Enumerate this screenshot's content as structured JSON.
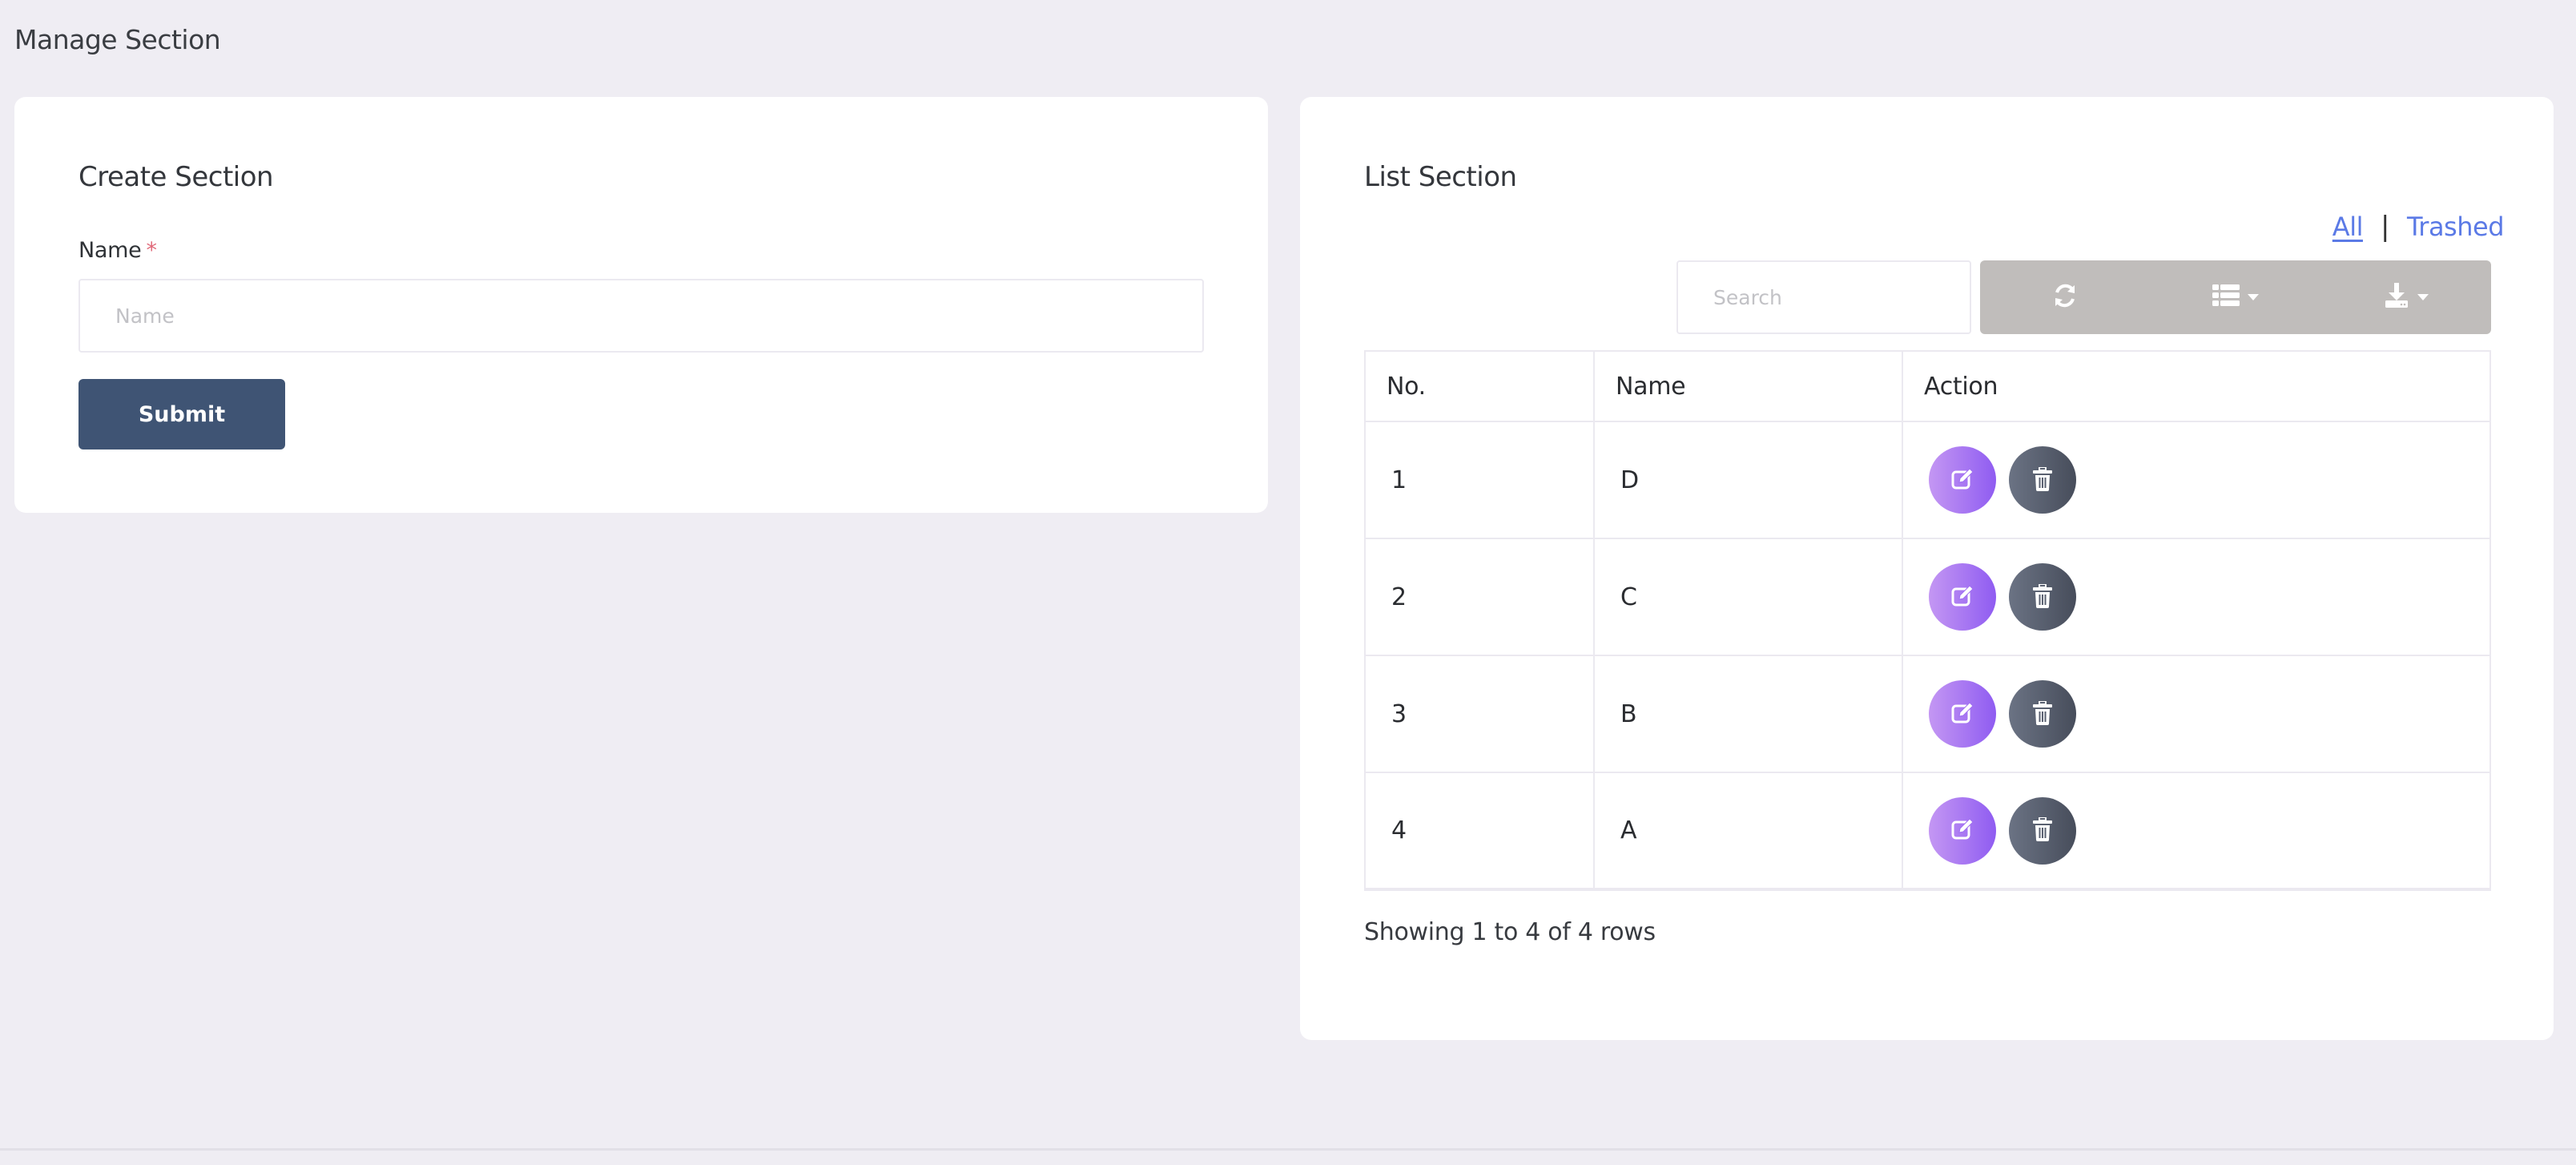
{
  "page": {
    "title": "Manage Section"
  },
  "create_section": {
    "title": "Create Section",
    "name_label": "Name",
    "required_marker": "*",
    "name_value": "",
    "name_placeholder": "Name",
    "submit_label": "Submit"
  },
  "list_section": {
    "title": "List Section",
    "filters": {
      "all_label": "All",
      "separator": "|",
      "trashed_label": "Trashed",
      "active": "All"
    },
    "search": {
      "value": "",
      "placeholder": "Search"
    },
    "toolbar": {
      "refresh_icon": "refresh-icon",
      "columns_icon": "list-columns-icon",
      "export_icon": "download-icon"
    },
    "table": {
      "columns": [
        "No.",
        "Name",
        "Action"
      ],
      "rows": [
        {
          "no": "1",
          "name": "D"
        },
        {
          "no": "2",
          "name": "C"
        },
        {
          "no": "3",
          "name": "B"
        },
        {
          "no": "4",
          "name": "A"
        }
      ]
    },
    "summary": "Showing 1 to 4 of 4 rows"
  },
  "colors": {
    "background": "#efedf3",
    "submit": "#3f5474",
    "link": "#5b7ae6",
    "edit_gradient": [
      "#c497f3",
      "#8f5cf1"
    ],
    "delete_gradient": [
      "#6b7384",
      "#474d5b"
    ],
    "toolbar": "#c0bdbb",
    "required": "#e06a7a"
  }
}
